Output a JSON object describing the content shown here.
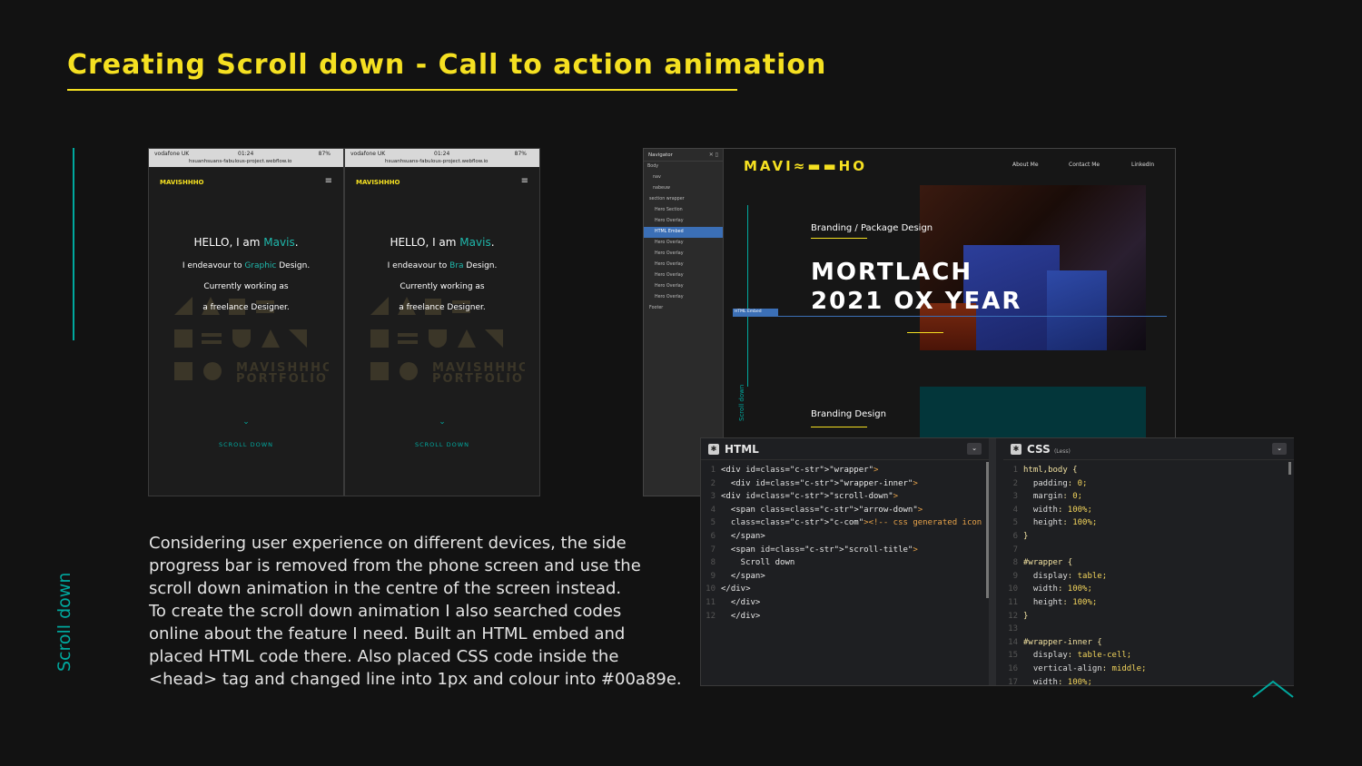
{
  "title": "Creating Scroll down - Call to action animation",
  "side_label": "Scroll down",
  "description": [
    "Considering user experience on different devices, the side",
    "progress bar is removed from the phone screen and use the",
    "scroll down animation in the centre of the screen instead.",
    "To create the scroll down animation I also searched codes",
    "online about the feature I need. Built an HTML embed and",
    "placed HTML code there. Also placed CSS code inside the",
    "<head> tag and changed line into 1px and colour into #00a89e."
  ],
  "phones": [
    {
      "carrier": "vodafone UK",
      "time": "01:24",
      "battery": "87%",
      "url": "hsuanhsuans-fabulous-project.webflow.io",
      "logo": "MAVISHHHO",
      "hello_prefix": "HELLO, I am ",
      "name": "Mavis",
      "hello_suffix": ".",
      "endeavour_prefix": "I endeavour to ",
      "endeavour_word": "Graphic",
      "endeavour_suffix": " Design.",
      "working": "Currently working as",
      "freelance": "a freelance Designer.",
      "portfolio_1": "MAVISHHHO",
      "portfolio_2": "PORTFOLIO",
      "scroll": "SCROLL DOWN"
    },
    {
      "carrier": "vodafone UK",
      "time": "01:24",
      "battery": "87%",
      "url": "hsuanhsuans-fabulous-project.webflow.io",
      "logo": "MAVISHHHO",
      "hello_prefix": "HELLO, I am ",
      "name": "Mavis",
      "hello_suffix": ".",
      "endeavour_prefix": "I endeavour to ",
      "endeavour_word": "Bra",
      "endeavour_suffix": " Design.",
      "working": "Currently working as",
      "freelance": "a freelance Designer.",
      "portfolio_1": "MAVISHHHO",
      "portfolio_2": "PORTFOLIO",
      "scroll": "SCROLL DOWN"
    }
  ],
  "designer": {
    "navigator_title": "Navigator",
    "nav_items": [
      "Body",
      "nav",
      "nabeuw",
      "section wrapper",
      "Hero Section",
      "Hero Overlay",
      "HTML Embed",
      "Hero Overlay",
      "Hero Overlay",
      "Hero Overlay",
      "Hero Overlay",
      "Hero Overlay",
      "Hero Overlay",
      "Footer"
    ],
    "logo": "MAVI",
    "logo_rest": "HO",
    "nav_links": [
      "About Me",
      "Contact Me",
      "LinkedIn"
    ],
    "category_1": "Branding / Package Design",
    "headline_1": "MORTLACH",
    "headline_2": "2021 OX YEAR",
    "embed_tag": "HTML Embed",
    "scroll_text": "Scroll down",
    "category_2": "Branding Design"
  },
  "html_panel": {
    "title": "HTML",
    "lines": [
      [
        "1",
        "<div id=\"wrapper\">"
      ],
      [
        "2",
        "  <div id=\"wrapper-inner\">"
      ],
      [
        "3",
        "<div id=\"scroll-down\">"
      ],
      [
        "4",
        "  <span class=\"arrow-down\">"
      ],
      [
        "5",
        "  <!-- css generated icon -->"
      ],
      [
        "6",
        "  </span>"
      ],
      [
        "7",
        "  <span id=\"scroll-title\">"
      ],
      [
        "8",
        "    Scroll down"
      ],
      [
        "9",
        "  </span>"
      ],
      [
        "10",
        "</div>"
      ],
      [
        "11",
        "  </div>"
      ],
      [
        "12",
        "  </div>"
      ]
    ]
  },
  "css_panel": {
    "title": "CSS",
    "subtitle": "(Less)",
    "lines": [
      [
        "1",
        "html,body {"
      ],
      [
        "2",
        "  padding:0;"
      ],
      [
        "3",
        "  margin:0;"
      ],
      [
        "4",
        "  width:100%;"
      ],
      [
        "5",
        "  height:100%;"
      ],
      [
        "6",
        "}"
      ],
      [
        "7",
        ""
      ],
      [
        "8",
        "#wrapper {"
      ],
      [
        "9",
        "  display: table;"
      ],
      [
        "10",
        "  width:100%;"
      ],
      [
        "11",
        "  height:100%;"
      ],
      [
        "12",
        "}"
      ],
      [
        "13",
        ""
      ],
      [
        "14",
        "#wrapper-inner {"
      ],
      [
        "15",
        "  display: table-cell;"
      ],
      [
        "16",
        "  vertical-align:middle;"
      ],
      [
        "17",
        "  width:100%;"
      ]
    ]
  },
  "colors": {
    "accent_yellow": "#f5e021",
    "accent_teal": "#00a89e",
    "background": "#121212"
  }
}
